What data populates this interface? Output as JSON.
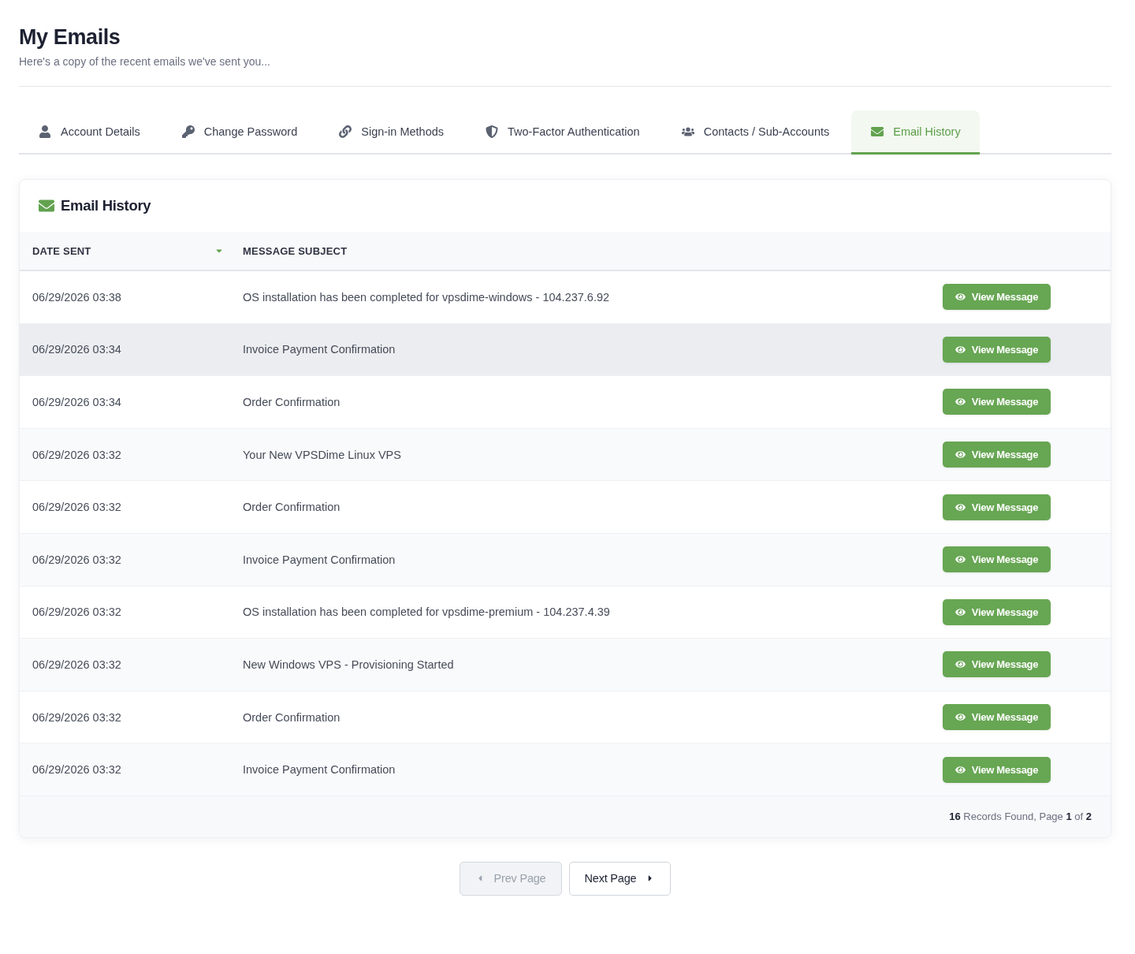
{
  "page": {
    "title": "My Emails",
    "subtitle": "Here's a copy of the recent emails we've sent you..."
  },
  "tabs": [
    {
      "label": "Account Details",
      "selected": false
    },
    {
      "label": "Change Password",
      "selected": false
    },
    {
      "label": "Sign-in Methods",
      "selected": false
    },
    {
      "label": "Two-Factor Authentication",
      "selected": false
    },
    {
      "label": "Contacts / Sub-Accounts",
      "selected": false
    },
    {
      "label": "Email History",
      "selected": true
    }
  ],
  "card": {
    "title": "Email History"
  },
  "table": {
    "columns": [
      {
        "label": "DATE SENT",
        "sorted": true
      },
      {
        "label": "MESSAGE SUBJECT",
        "sorted": false
      }
    ],
    "rows": [
      {
        "date": "06/29/2026 03:38",
        "subject": "OS installation has been completed for vpsdime-windows - 104.237.6.92",
        "action": "View Message",
        "hovered": false
      },
      {
        "date": "06/29/2026 03:34",
        "subject": "Invoice Payment Confirmation",
        "action": "View Message",
        "hovered": true
      },
      {
        "date": "06/29/2026 03:34",
        "subject": "Order Confirmation",
        "action": "View Message",
        "hovered": false
      },
      {
        "date": "06/29/2026 03:32",
        "subject": "Your New VPSDime Linux VPS",
        "action": "View Message",
        "hovered": false
      },
      {
        "date": "06/29/2026 03:32",
        "subject": "Order Confirmation",
        "action": "View Message",
        "hovered": false
      },
      {
        "date": "06/29/2026 03:32",
        "subject": "Invoice Payment Confirmation",
        "action": "View Message",
        "hovered": false
      },
      {
        "date": "06/29/2026 03:32",
        "subject": "OS installation has been completed for vpsdime-premium - 104.237.4.39",
        "action": "View Message",
        "hovered": false
      },
      {
        "date": "06/29/2026 03:32",
        "subject": "New Windows VPS - Provisioning Started",
        "action": "View Message",
        "hovered": false
      },
      {
        "date": "06/29/2026 03:32",
        "subject": "Order Confirmation",
        "action": "View Message",
        "hovered": false
      },
      {
        "date": "06/29/2026 03:32",
        "subject": "Invoice Payment Confirmation",
        "action": "View Message",
        "hovered": false
      }
    ],
    "footer": "**16** Records Found, Page **1** of **2**"
  },
  "pagination": {
    "prev": {
      "label": "Prev Page",
      "disabled": true
    },
    "next": {
      "label": "Next Page",
      "disabled": false
    }
  }
}
